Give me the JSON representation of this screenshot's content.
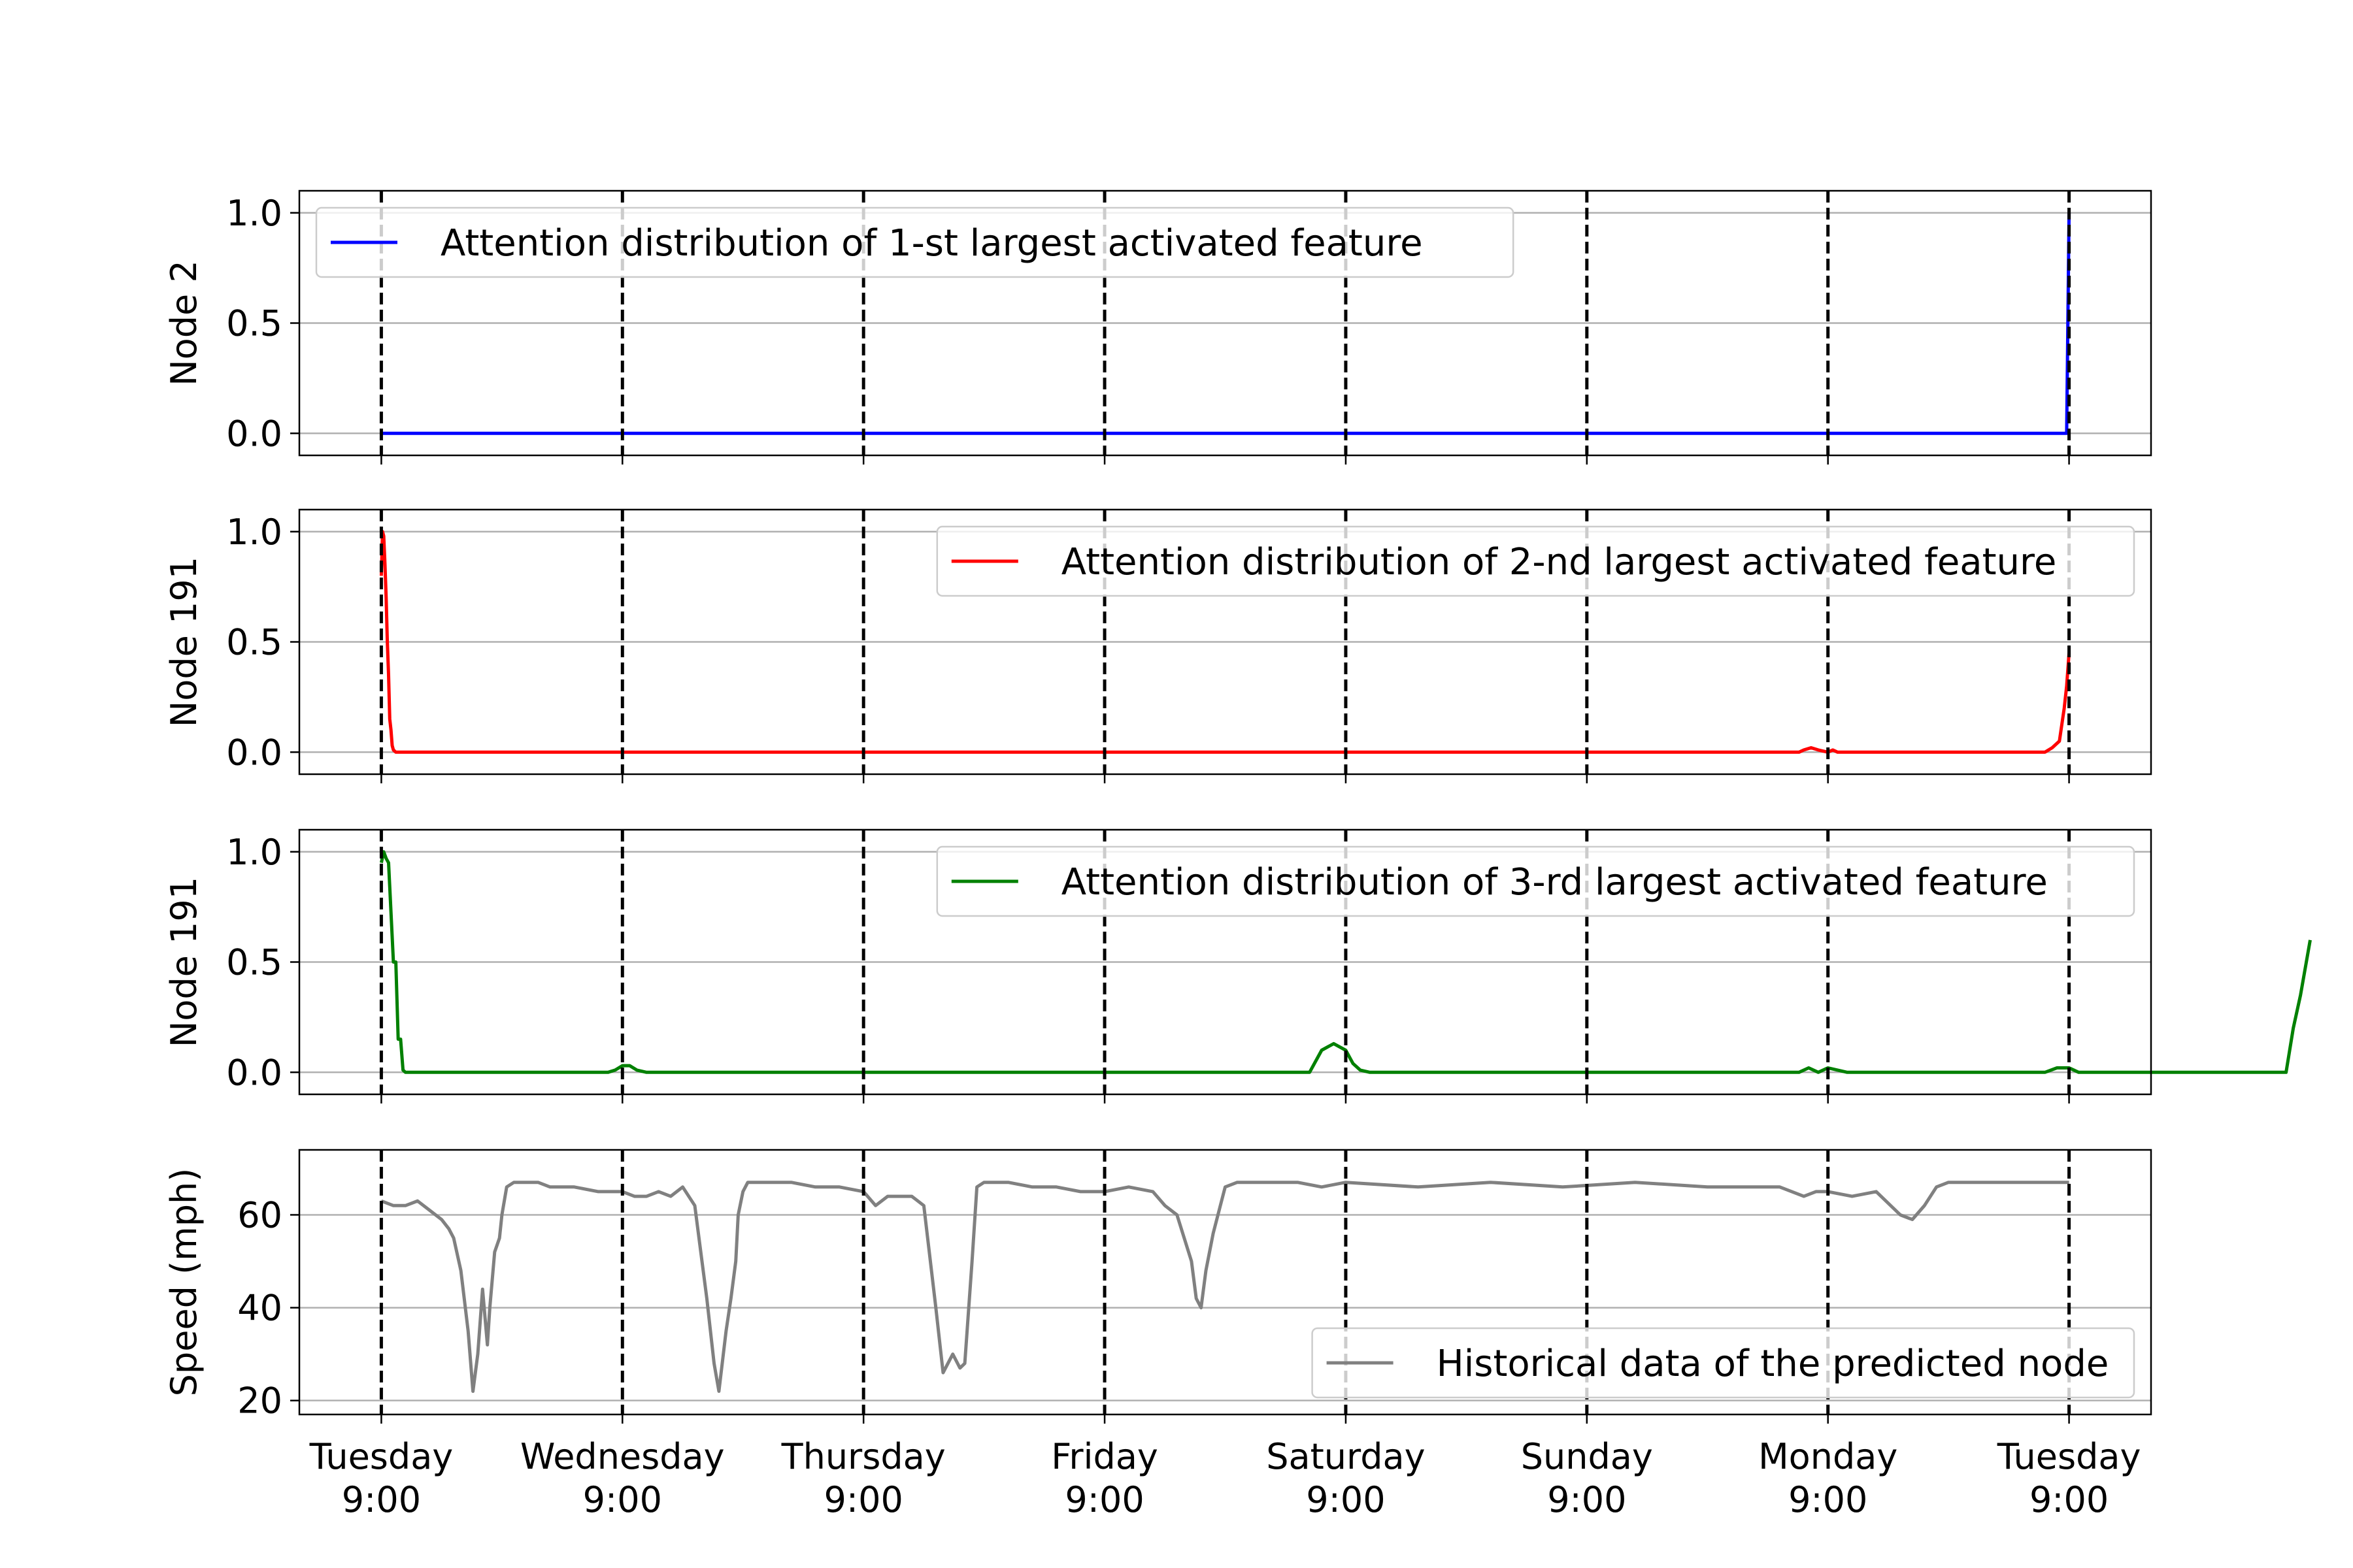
{
  "chart_data": [
    {
      "type": "line",
      "ylabel": "Node 2",
      "ylim": [
        -0.1,
        1.1
      ],
      "yticks": [
        "0.0",
        "0.5",
        "1.0"
      ],
      "grid": "y",
      "legend_placement": "top-left",
      "series": [
        {
          "name": "Attention distribution of 1-st largest activated feature",
          "color": "#0000ff",
          "x": [
            0,
            6.99,
            7.0
          ],
          "y": [
            0,
            0,
            1.0
          ]
        }
      ]
    },
    {
      "type": "line",
      "ylabel": "Node 191",
      "ylim": [
        -0.1,
        1.1
      ],
      "yticks": [
        "0.0",
        "0.5",
        "1.0"
      ],
      "grid": "y",
      "legend_placement": "top-right",
      "series": [
        {
          "name": "Attention distribution of 2-nd largest activated feature",
          "color": "#ff0000",
          "x": [
            0,
            0.005,
            0.01,
            0.015,
            0.02,
            0.025,
            0.03,
            0.035,
            0.04,
            0.045,
            0.05,
            0.06,
            0.07,
            5.88,
            5.9,
            5.93,
            5.96,
            6.0,
            6.02,
            6.04,
            6.9,
            6.93,
            6.96,
            6.98,
            6.99,
            7.0
          ],
          "y": [
            0.8,
            1.0,
            0.98,
            0.85,
            0.7,
            0.5,
            0.35,
            0.15,
            0.1,
            0.03,
            0.01,
            0.0,
            0.0,
            0.0,
            0.01,
            0.02,
            0.01,
            0.0,
            0.01,
            0.0,
            0.0,
            0.02,
            0.05,
            0.2,
            0.3,
            0.45
          ]
        }
      ]
    },
    {
      "type": "line",
      "ylabel": "Node 191",
      "ylim": [
        -0.1,
        1.1
      ],
      "yticks": [
        "0.0",
        "0.5",
        "1.0"
      ],
      "grid": "y",
      "legend_placement": "top-right",
      "series": [
        {
          "name": "Attention distribution of 3-rd largest activated feature",
          "color": "#008000",
          "x": [
            0,
            0.01,
            0.02,
            0.03,
            0.05,
            0.06,
            0.07,
            0.08,
            0.09,
            0.1,
            0.94,
            0.97,
            1.0,
            1.03,
            1.06,
            1.1,
            3.85,
            3.9,
            3.95,
            4.0,
            4.03,
            4.06,
            4.1,
            5.88,
            5.92,
            5.96,
            6.0,
            6.04,
            6.08,
            6.9,
            6.95,
            7.0,
            7.04,
            7.08,
            7.9,
            7.93,
            7.96,
            8.0
          ],
          "y": [
            0.95,
            1.0,
            0.97,
            0.95,
            0.5,
            0.5,
            0.15,
            0.15,
            0.01,
            0.0,
            0.0,
            0.01,
            0.03,
            0.03,
            0.01,
            0.0,
            0.0,
            0.1,
            0.13,
            0.1,
            0.04,
            0.01,
            0.0,
            0.0,
            0.02,
            0.0,
            0.02,
            0.01,
            0.0,
            0.0,
            0.02,
            0.02,
            0.0,
            0.0,
            0.0,
            0.2,
            0.35,
            0.6
          ]
        }
      ]
    },
    {
      "type": "line",
      "ylabel": "Speed (mph)",
      "ylim": [
        17,
        74
      ],
      "yticks": [
        "20",
        "40",
        "60"
      ],
      "grid": "y",
      "legend_placement": "bottom-right",
      "series": [
        {
          "name": "Historical data of the predicted node",
          "color": "#808080",
          "x": [
            0,
            0.05,
            0.1,
            0.15,
            0.2,
            0.25,
            0.28,
            0.3,
            0.33,
            0.36,
            0.38,
            0.4,
            0.42,
            0.44,
            0.45,
            0.47,
            0.49,
            0.5,
            0.52,
            0.55,
            0.58,
            0.6,
            0.65,
            0.7,
            0.8,
            0.9,
            1.0,
            1.05,
            1.1,
            1.15,
            1.2,
            1.25,
            1.3,
            1.33,
            1.35,
            1.38,
            1.4,
            1.43,
            1.45,
            1.47,
            1.48,
            1.5,
            1.52,
            1.55,
            1.6,
            1.7,
            1.8,
            1.9,
            2.0,
            2.05,
            2.1,
            2.15,
            2.2,
            2.25,
            2.3,
            2.33,
            2.35,
            2.37,
            2.4,
            2.42,
            2.45,
            2.47,
            2.5,
            2.55,
            2.6,
            2.7,
            2.8,
            2.9,
            3.0,
            3.1,
            3.2,
            3.25,
            3.3,
            3.33,
            3.36,
            3.38,
            3.4,
            3.42,
            3.45,
            3.48,
            3.5,
            3.55,
            3.6,
            3.7,
            3.8,
            3.9,
            4.0,
            4.3,
            4.6,
            4.9,
            5.2,
            5.5,
            5.8,
            5.9,
            5.95,
            6.0,
            6.1,
            6.2,
            6.3,
            6.35,
            6.4,
            6.45,
            6.5,
            6.6,
            6.8,
            7.0
          ],
          "y": [
            63,
            62,
            62,
            63,
            61,
            59,
            57,
            55,
            48,
            35,
            22,
            30,
            44,
            32,
            40,
            52,
            55,
            60,
            66,
            67,
            67,
            67,
            67,
            66,
            66,
            65,
            65,
            64,
            64,
            65,
            64,
            66,
            62,
            50,
            42,
            28,
            22,
            35,
            42,
            50,
            60,
            65,
            67,
            67,
            67,
            67,
            66,
            66,
            65,
            62,
            64,
            64,
            64,
            62,
            40,
            26,
            28,
            30,
            27,
            28,
            50,
            66,
            67,
            67,
            67,
            66,
            66,
            65,
            65,
            66,
            65,
            62,
            60,
            55,
            50,
            42,
            40,
            48,
            56,
            62,
            66,
            67,
            67,
            67,
            67,
            66,
            67,
            66,
            67,
            66,
            67,
            66,
            66,
            64,
            65,
            65,
            64,
            65,
            60,
            59,
            62,
            66,
            67,
            67,
            67,
            67
          ]
        }
      ]
    }
  ],
  "x_axis": {
    "xlim": [
      -0.34,
      7.34
    ],
    "ticks": [
      {
        "day": "Tuesday",
        "time": "9:00"
      },
      {
        "day": "Wednesday",
        "time": "9:00"
      },
      {
        "day": "Thursday",
        "time": "9:00"
      },
      {
        "day": "Friday",
        "time": "9:00"
      },
      {
        "day": "Saturday",
        "time": "9:00"
      },
      {
        "day": "Sunday",
        "time": "9:00"
      },
      {
        "day": "Monday",
        "time": "9:00"
      },
      {
        "day": "Tuesday",
        "time": "9:00"
      }
    ],
    "vlines": [
      0,
      1,
      2,
      3,
      4,
      5,
      6,
      7
    ]
  },
  "style": {
    "grid_color": "#b0b0b0",
    "vline_color": "#000000",
    "legend_border": "#cccccc"
  }
}
